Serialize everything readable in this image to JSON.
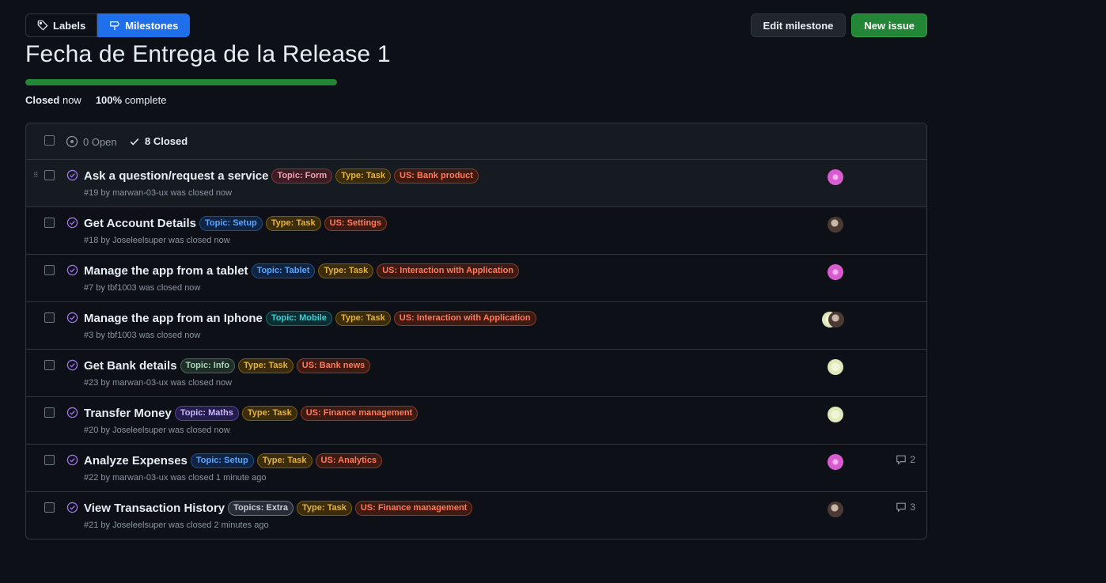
{
  "toolbar": {
    "labels_label": "Labels",
    "milestones_label": "Milestones",
    "edit_label": "Edit milestone",
    "new_issue_label": "New issue"
  },
  "milestone": {
    "title": "Fecha de Entrega de la Release 1",
    "progress_percent": 100,
    "status_bold": "Closed",
    "status_rest": "now",
    "complete_bold": "100%",
    "complete_rest": "complete"
  },
  "list": {
    "open_label": "0 Open",
    "closed_label": "8 Closed"
  },
  "colors": {
    "accent_blue": "#1f6feb",
    "green": "#238636",
    "closed_purple": "#a371f7"
  },
  "issues": [
    {
      "title": "Ask a question/request a service",
      "sub": "#19 by marwan-03-ux was closed now",
      "labels": [
        {
          "text": "Topic: Form",
          "fg": "#f0a3ae",
          "bg": "#3d1d24",
          "bd": "#7d3440"
        },
        {
          "text": "Type: Task",
          "fg": "#e3b341",
          "bg": "#3b2d0c",
          "bd": "#7a5c11"
        },
        {
          "text": "US: Bank product",
          "fg": "#ff7b5c",
          "bg": "#3d1a12",
          "bd": "#8a3b28"
        }
      ],
      "avatar": "pink",
      "comments": ""
    },
    {
      "title": "Get Account Details",
      "sub": "#18 by Joseleelsuper was closed now",
      "labels": [
        {
          "text": "Topic: Setup",
          "fg": "#58a6ff",
          "bg": "#0f2342",
          "bd": "#1f4f8a"
        },
        {
          "text": "Type: Task",
          "fg": "#e3b341",
          "bg": "#3b2d0c",
          "bd": "#7a5c11"
        },
        {
          "text": "US: Settings",
          "fg": "#ff7b5c",
          "bg": "#3d1a12",
          "bd": "#8a3b28"
        }
      ],
      "avatar": "brown",
      "comments": ""
    },
    {
      "title": "Manage the app from a tablet",
      "sub": "#7 by tbf1003 was closed now",
      "labels": [
        {
          "text": "Topic: Tablet",
          "fg": "#58a6ff",
          "bg": "#0f2342",
          "bd": "#1f4f8a"
        },
        {
          "text": "Type: Task",
          "fg": "#e3b341",
          "bg": "#3b2d0c",
          "bd": "#7a5c11"
        },
        {
          "text": "US: Interaction with Application",
          "fg": "#ff7b5c",
          "bg": "#3d1a12",
          "bd": "#8a3b28"
        }
      ],
      "avatar": "pink",
      "comments": ""
    },
    {
      "title": "Manage the app from an Iphone",
      "sub": "#3 by tbf1003 was closed now",
      "labels": [
        {
          "text": "Topic: Mobile",
          "fg": "#39d0d8",
          "bg": "#0a2e31",
          "bd": "#1b6a70"
        },
        {
          "text": "Type: Task",
          "fg": "#e3b341",
          "bg": "#3b2d0c",
          "bd": "#7a5c11"
        },
        {
          "text": "US: Interaction with Application",
          "fg": "#ff7b5c",
          "bg": "#3d1a12",
          "bd": "#8a3b28"
        }
      ],
      "avatar": "pair",
      "comments": ""
    },
    {
      "title": "Get Bank details",
      "sub": "#23 by marwan-03-ux was closed now",
      "labels": [
        {
          "text": "Topic: Info",
          "fg": "#a8d5b9",
          "bg": "#1f2e27",
          "bd": "#4a6656"
        },
        {
          "text": "Type: Task",
          "fg": "#e3b341",
          "bg": "#3b2d0c",
          "bd": "#7a5c11"
        },
        {
          "text": "US: Bank news",
          "fg": "#ff7b5c",
          "bg": "#3d1a12",
          "bd": "#8a3b28"
        }
      ],
      "avatar": "light",
      "comments": ""
    },
    {
      "title": "Transfer Money",
      "sub": "#20 by Joseleelsuper was closed now",
      "labels": [
        {
          "text": "Topic: Maths",
          "fg": "#c6b7ff",
          "bg": "#241c4a",
          "bd": "#5441a8"
        },
        {
          "text": "Type: Task",
          "fg": "#e3b341",
          "bg": "#3b2d0c",
          "bd": "#7a5c11"
        },
        {
          "text": "US: Finance management",
          "fg": "#ff7b5c",
          "bg": "#3d1a12",
          "bd": "#8a3b28"
        }
      ],
      "avatar": "light",
      "comments": ""
    },
    {
      "title": "Analyze Expenses",
      "sub": "#22 by marwan-03-ux was closed 1 minute ago",
      "labels": [
        {
          "text": "Topic: Setup",
          "fg": "#58a6ff",
          "bg": "#0f2342",
          "bd": "#1f4f8a"
        },
        {
          "text": "Type: Task",
          "fg": "#e3b341",
          "bg": "#3b2d0c",
          "bd": "#7a5c11"
        },
        {
          "text": "US: Analytics",
          "fg": "#ff7b5c",
          "bg": "#3d1a12",
          "bd": "#8a3b28"
        }
      ],
      "avatar": "pink",
      "comments": "2"
    },
    {
      "title": "View Transaction History",
      "sub": "#21 by Joseleelsuper was closed 2 minutes ago",
      "labels": [
        {
          "text": "Topics: Extra",
          "fg": "#c9d1d9",
          "bg": "#272d36",
          "bd": "#6e7681"
        },
        {
          "text": "Type: Task",
          "fg": "#e3b341",
          "bg": "#3b2d0c",
          "bd": "#7a5c11"
        },
        {
          "text": "US: Finance management",
          "fg": "#ff7b5c",
          "bg": "#3d1a12",
          "bd": "#8a3b28"
        }
      ],
      "avatar": "brown",
      "comments": "3"
    }
  ]
}
